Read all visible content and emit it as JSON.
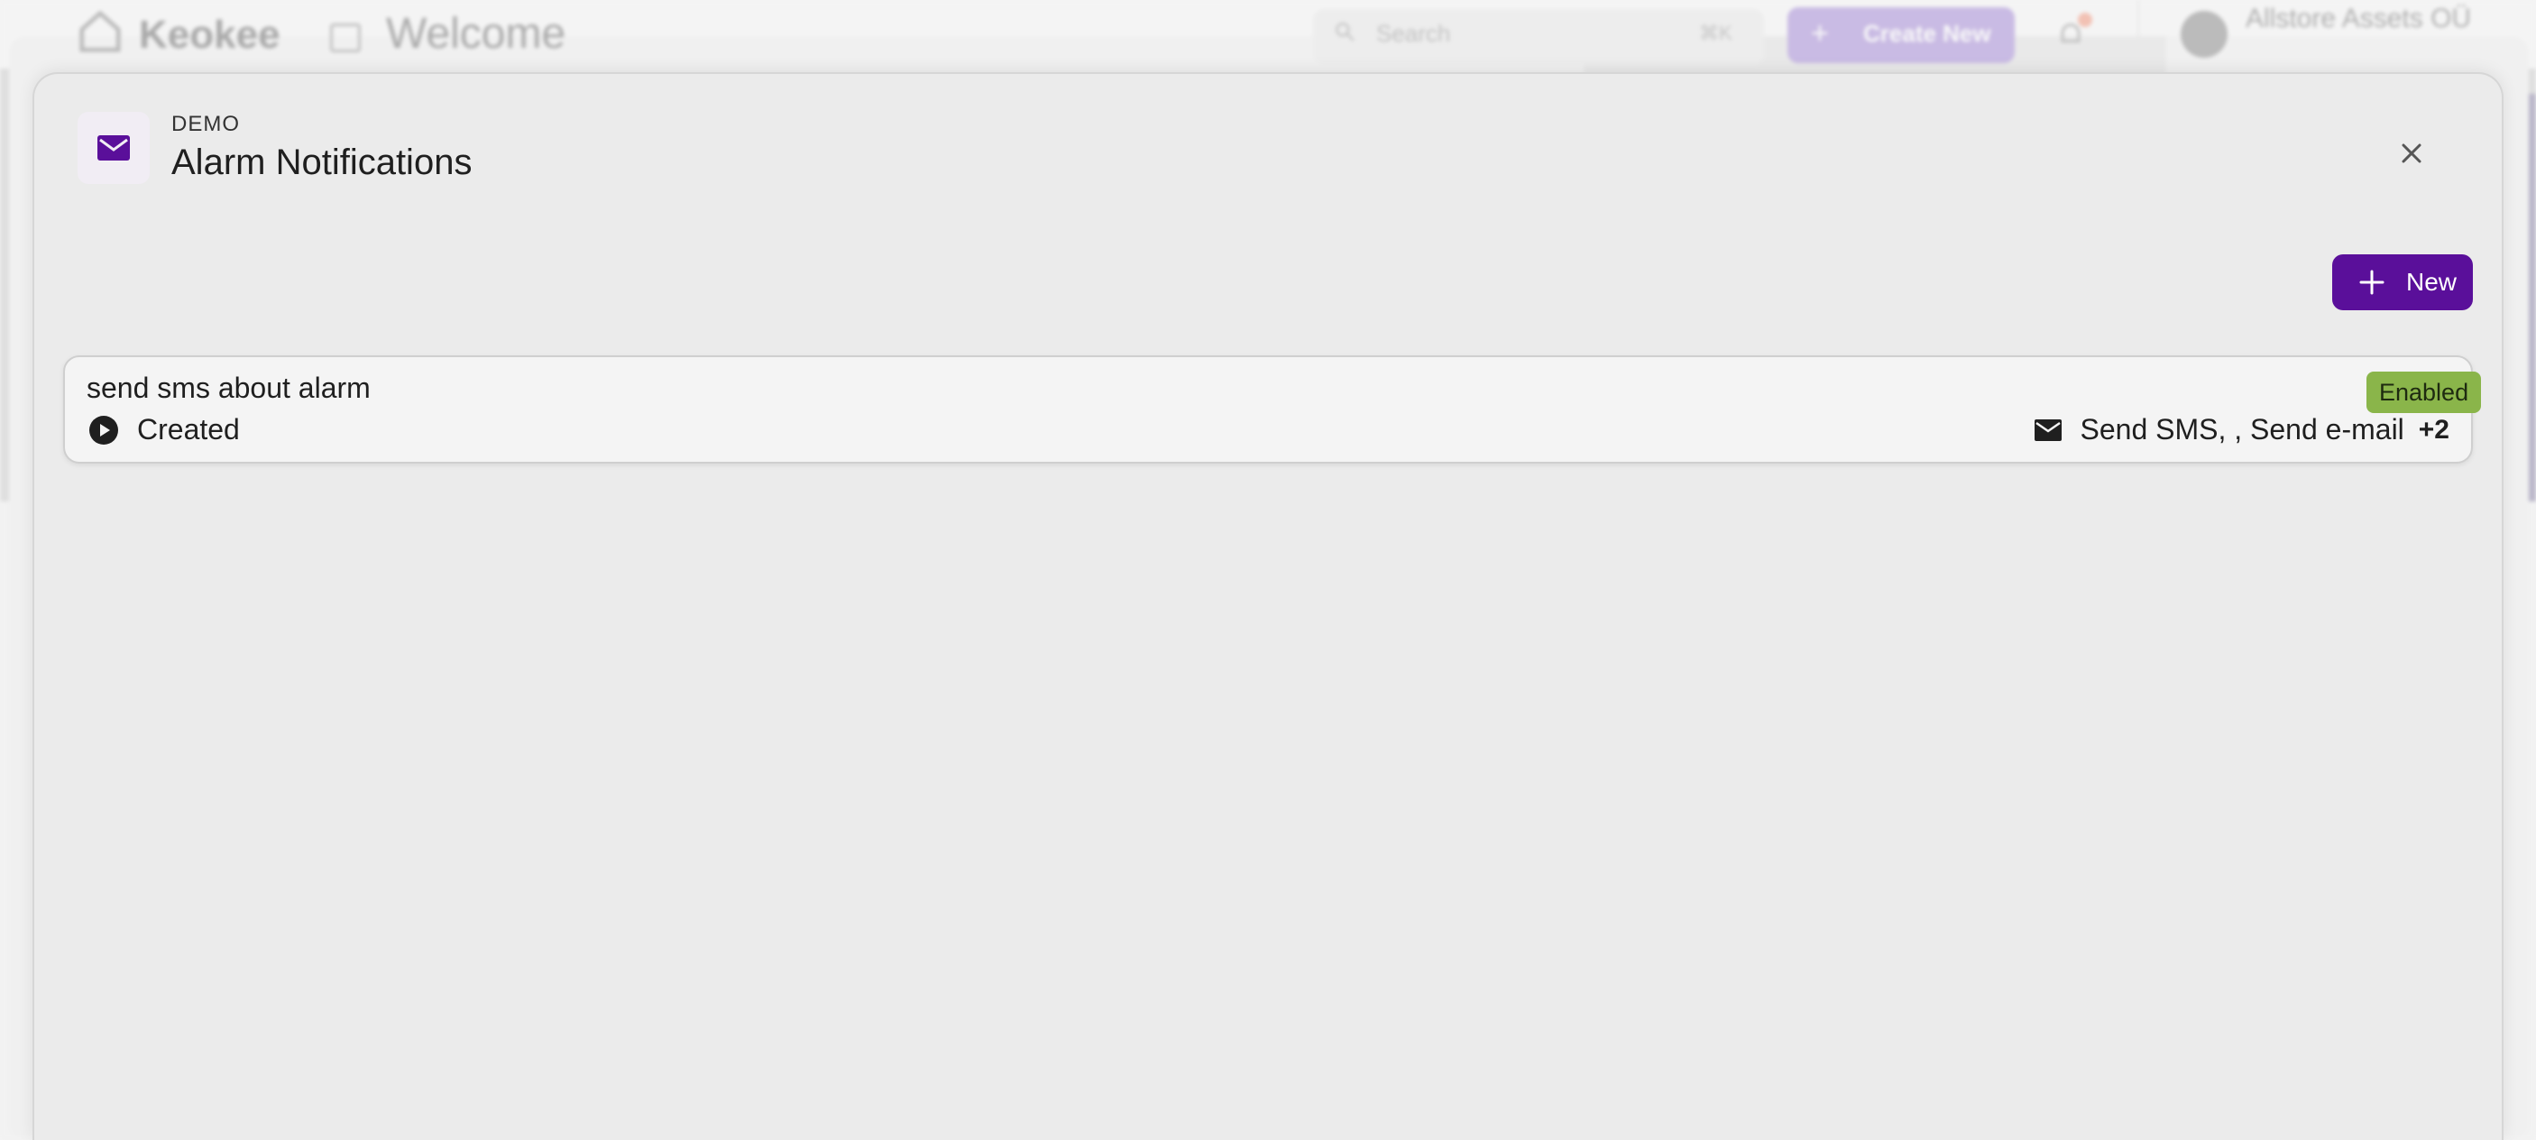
{
  "background": {
    "app_name": "Keokee",
    "page_title": "Welcome",
    "search_placeholder": "Search",
    "search_shortcut": "⌘K",
    "create_button_label": "Create New",
    "organization_name": "Allstore Assets OÜ"
  },
  "modal": {
    "eyebrow": "DEMO",
    "title": "Alarm Notifications",
    "icon": "envelope-icon",
    "close_icon": "close-icon",
    "new_button_label": "New"
  },
  "rules": [
    {
      "name": "send sms about alarm",
      "trigger": "Created",
      "trigger_icon": "play-circle-icon",
      "status": "Enabled",
      "actions_icon": "envelope-icon",
      "actions_text": "Send SMS, , Send e-mail",
      "more_count": "+2"
    }
  ],
  "colors": {
    "accent": "#5a0f9a",
    "enabled_badge": "#8ab54a"
  }
}
